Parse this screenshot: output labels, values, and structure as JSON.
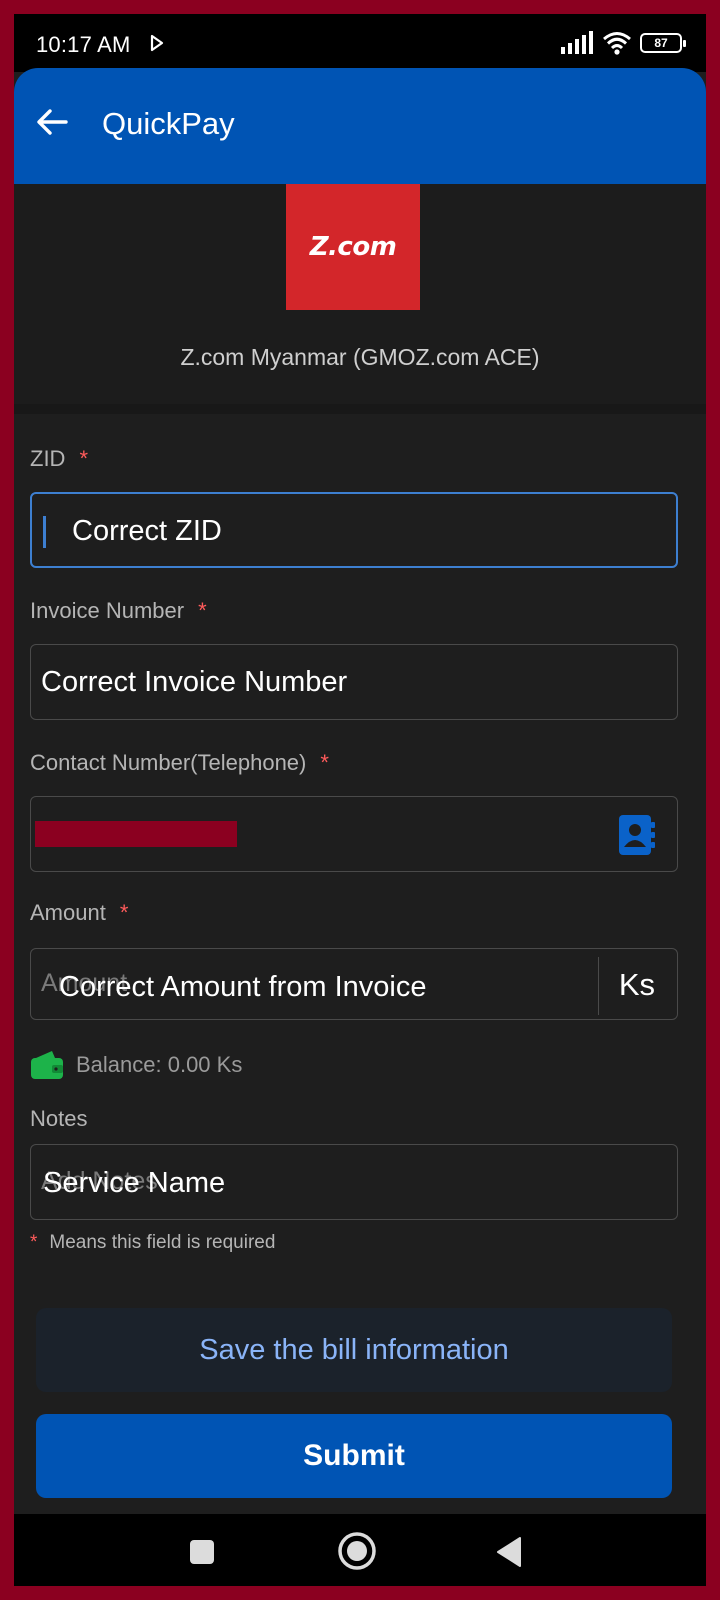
{
  "status_bar": {
    "time": "10:17 AM",
    "battery": "87"
  },
  "app_bar": {
    "title": "QuickPay"
  },
  "merchant": {
    "logo_text": "Z.com",
    "name": "Z.com Myanmar (GMOZ.com ACE)"
  },
  "form": {
    "zid": {
      "label": "ZID",
      "required_mark": "*",
      "value": "Correct ZID"
    },
    "invoice": {
      "label": "Invoice Number",
      "required_mark": "*",
      "value": "Correct Invoice Number"
    },
    "contact": {
      "label": "Contact Number(Telephone)",
      "required_mark": "*",
      "value": ""
    },
    "amount": {
      "label": "Amount",
      "required_mark": "*",
      "placeholder": "Amount",
      "value": "Correct Amount from Invoice",
      "currency": "Ks"
    },
    "balance": "Balance: 0.00 Ks",
    "notes": {
      "label": "Notes",
      "placeholder": "Add Notes",
      "value": "Service Name"
    },
    "required_note": {
      "mark": "*",
      "text": "Means this field is required"
    }
  },
  "buttons": {
    "save": "Save the bill information",
    "submit": "Submit"
  },
  "colors": {
    "primary": "#0054b4",
    "required": "#ff5b5b",
    "link": "#8ab4f8",
    "logo": "#d3262a",
    "wallet": "#1db34a"
  }
}
